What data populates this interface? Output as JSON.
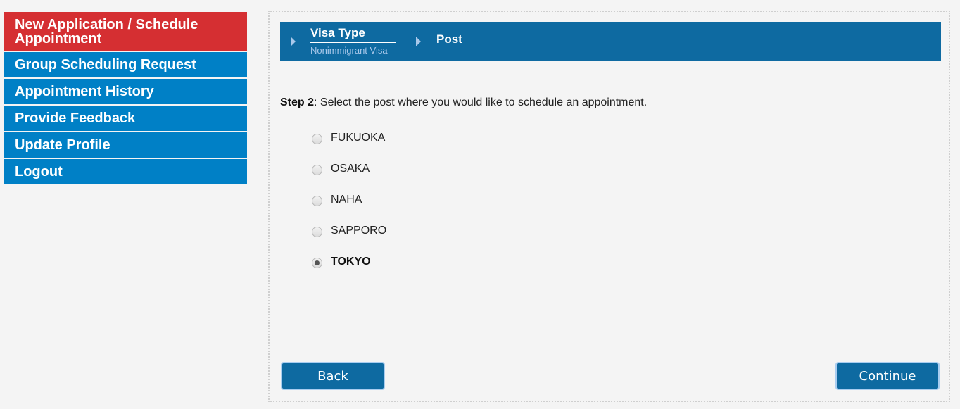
{
  "sidebar": {
    "items": [
      {
        "label": "New Application / Schedule Appointment",
        "active": true
      },
      {
        "label": "Group Scheduling Request"
      },
      {
        "label": "Appointment History"
      },
      {
        "label": "Provide Feedback"
      },
      {
        "label": "Update Profile"
      },
      {
        "label": "Logout"
      }
    ]
  },
  "breadcrumb": {
    "steps": [
      {
        "title": "Visa Type",
        "subtitle": "Nonimmigrant Visa",
        "icon": "triangle-right-icon"
      },
      {
        "title": "Post",
        "icon": "triangle-right-icon"
      }
    ]
  },
  "step": {
    "label": "Step 2",
    "text": ": Select the post where you would like to schedule an appointment."
  },
  "posts": {
    "options": [
      {
        "label": "FUKUOKA",
        "checked": false
      },
      {
        "label": "OSAKA",
        "checked": false
      },
      {
        "label": "NAHA",
        "checked": false
      },
      {
        "label": "SAPPORO",
        "checked": false
      },
      {
        "label": "TOKYO",
        "checked": true
      }
    ],
    "selected": "TOKYO"
  },
  "buttons": {
    "back": "Back",
    "continue": "Continue"
  },
  "colors": {
    "active_nav": "#d52f32",
    "nav": "#0080c6",
    "header_bar": "#0e6aa1",
    "button": "#0e6aa1"
  }
}
